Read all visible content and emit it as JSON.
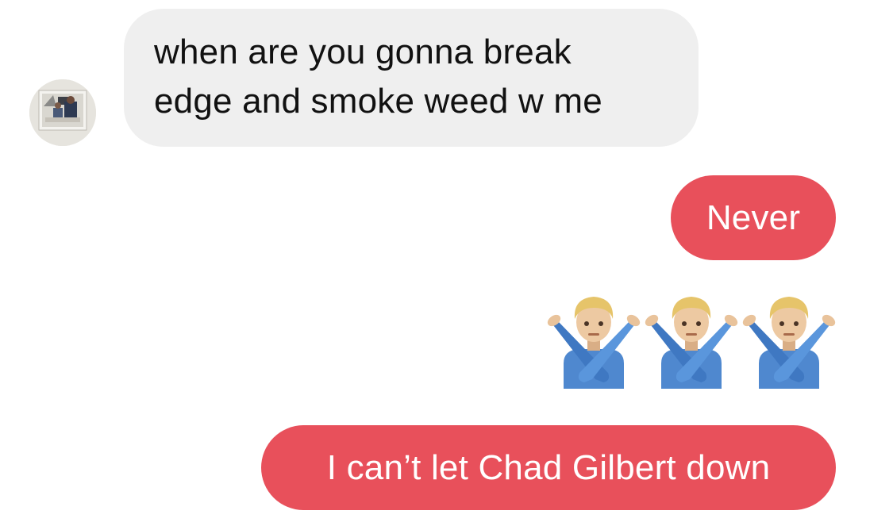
{
  "conversation": {
    "messages": [
      {
        "sender": "them",
        "lines": [
          "when are you gonna break",
          "edge and smoke weed w me"
        ]
      },
      {
        "sender": "me",
        "text": "Never"
      },
      {
        "sender": "me",
        "type": "emoji",
        "emoji": "🙅🏼‍♂️🙅🏼‍♂️🙅🏼‍♂️",
        "icons": [
          "no-gesture-man-icon",
          "no-gesture-man-icon",
          "no-gesture-man-icon"
        ]
      },
      {
        "sender": "me",
        "text": "I can’t let Chad Gilbert down"
      }
    ]
  },
  "colors": {
    "incoming_bubble": "#efefef",
    "outgoing_bubble": "#e8505b",
    "outgoing_text": "#ffffff",
    "incoming_text": "#111111"
  }
}
